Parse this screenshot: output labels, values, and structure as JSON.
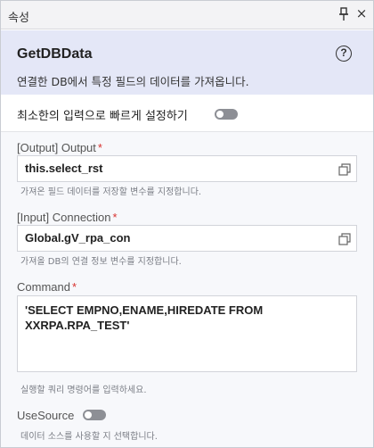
{
  "window": {
    "title": "속성",
    "close_glyph": "×"
  },
  "header": {
    "name": "GetDBData",
    "description": "연결한 DB에서 특정 필드의 데이터를 가져옵니다.",
    "help_glyph": "?"
  },
  "quick_setup": {
    "label": "최소한의 입력으로 빠르게 설정하기",
    "enabled": false
  },
  "fields": {
    "output": {
      "label": "[Output] Output",
      "required_mark": "*",
      "value": "this.select_rst",
      "hint": "가져온 필드 데이터를 저장할 변수를 지정합니다."
    },
    "connection": {
      "label": "[Input] Connection",
      "required_mark": "*",
      "value": "Global.gV_rpa_con",
      "hint": "가져올 DB의 연결 정보 변수를 지정합니다."
    },
    "command": {
      "label": "Command",
      "required_mark": "*",
      "value": "'SELECT EMPNO,ENAME,HIREDATE FROM XXRPA.RPA_TEST'",
      "hint": "실행할 쿼리 명령어를 입력하세요."
    },
    "use_source": {
      "label": "UseSource",
      "enabled": false,
      "hint": "데이터 소스를 사용할 지 선택합니다."
    }
  },
  "icons": {
    "pin": "pin-icon",
    "close": "close-icon",
    "help": "help-icon",
    "copy": "copy-icon"
  }
}
